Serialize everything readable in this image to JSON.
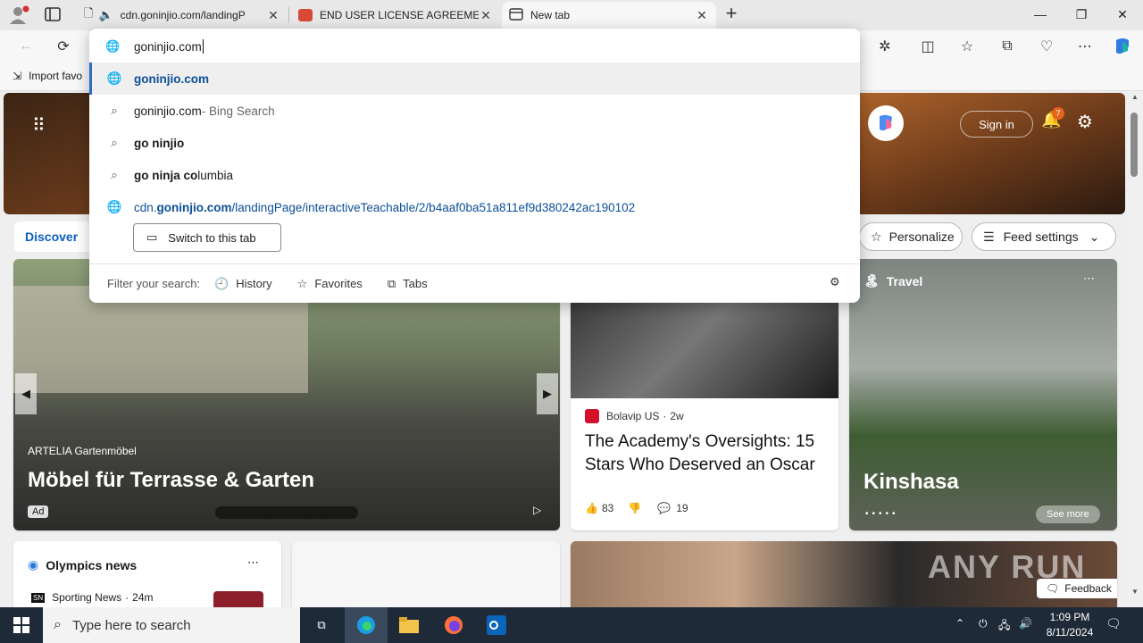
{
  "tabs": [
    {
      "title": "cdn.goninjio.com/landingP",
      "close": "✕"
    },
    {
      "title": "END USER LICENSE AGREEMENT",
      "close": "✕"
    },
    {
      "title": "New tab",
      "close": "✕"
    }
  ],
  "new_tab_symbol": "+",
  "window_controls": {
    "minimize": "—",
    "restore": "❐",
    "close": "✕"
  },
  "address_bar": {
    "value": "goninjio.com"
  },
  "favorites_bar": {
    "import_label": "Import favo"
  },
  "suggestions": [
    {
      "type": "url",
      "bold": "goninjio.com",
      "rest": "",
      "selected": true
    },
    {
      "type": "search",
      "bold": "",
      "rest": "goninjio.com",
      "hint": " - Bing Search"
    },
    {
      "type": "search",
      "bold": "go ninjio",
      "rest": ""
    },
    {
      "type": "search",
      "bold": "go ninja co",
      "rest": "lumbia"
    },
    {
      "type": "url",
      "prefix": "cdn.",
      "bold": "goninjio.com",
      "rest": "/landingPage/interactiveTeachable/2/b4aaf0ba51a811ef9d380242ac190102"
    }
  ],
  "switch_tab_label": "Switch to this tab",
  "filter": {
    "label": "Filter your search:",
    "history": "History",
    "favorites": "Favorites",
    "tabs": "Tabs"
  },
  "page": {
    "discover": "Discover",
    "signin": "Sign in",
    "notif_count": "7",
    "personalize": "Personalize",
    "feed_settings": "Feed settings",
    "ad_card": {
      "brand": "ARTELIA Gartenmöbel",
      "title": "Möbel für Terrasse & Garten",
      "ad": "Ad"
    },
    "news_card": {
      "source": "Bolavip US",
      "age": "2w",
      "title": "The Academy's Oversights: 15 Stars Who Deserved an Oscar",
      "likes": "83",
      "comments": "19"
    },
    "travel_card": {
      "category": "Travel",
      "title": "Kinshasa",
      "see_more": "See more"
    },
    "olympics": {
      "title": "Olympics news",
      "source": "Sporting News",
      "age": "24m",
      "sn": "SN"
    },
    "feedback": "Feedback",
    "watermark": "ANY RUN"
  },
  "taskbar": {
    "search_placeholder": "Type here to search",
    "time": "1:09 PM",
    "date": "8/11/2024"
  }
}
